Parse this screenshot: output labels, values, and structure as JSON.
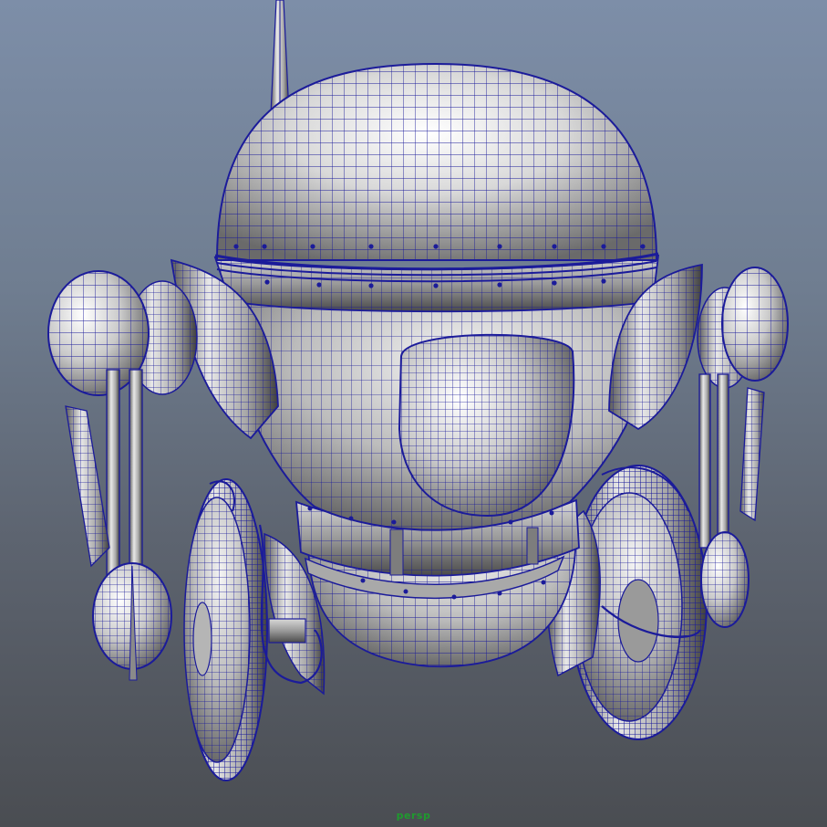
{
  "viewport": {
    "camera_label": "persp",
    "wire_color": "#1b1b9a",
    "label_color": "#1f9a2e"
  }
}
